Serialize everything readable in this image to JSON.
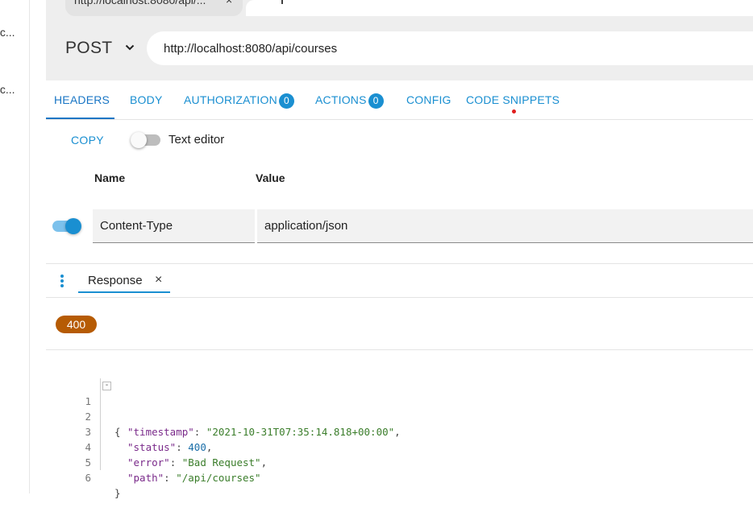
{
  "left_panel": {
    "items": [
      "fc...",
      "fc..."
    ]
  },
  "browser_tab": {
    "title": "http://localhost:8080/api/...",
    "close": "×",
    "new_tab": "+"
  },
  "request": {
    "method": "POST",
    "url": "http://localhost:8080/api/courses"
  },
  "tabs": [
    {
      "label": "HEADERS"
    },
    {
      "label": "BODY"
    },
    {
      "label": "AUTHORIZATION",
      "badge": "0"
    },
    {
      "label": "ACTIONS",
      "badge": "0"
    },
    {
      "label": "CONFIG"
    },
    {
      "label": "CODE SNIPPETS"
    }
  ],
  "headers_panel": {
    "copy_label": "COPY",
    "text_editor_label": "Text editor",
    "col_name": "Name",
    "col_value": "Value",
    "rows": [
      {
        "name": "Content-Type",
        "value": "application/json",
        "enabled": true
      }
    ]
  },
  "response": {
    "tab_label": "Response",
    "close": "×",
    "status": "400",
    "status_color": "#b65b04",
    "body_lines": [
      {
        "n": "1",
        "text": "{"
      },
      {
        "n": "2",
        "key": "\"timestamp\"",
        "value": "\"2021-10-31T07:35:14.818+00:00\"",
        "type": "str",
        "trail": ","
      },
      {
        "n": "3",
        "key": "\"status\"",
        "value": "400",
        "type": "num",
        "trail": ","
      },
      {
        "n": "4",
        "key": "\"error\"",
        "value": "\"Bad Request\"",
        "type": "str",
        "trail": ","
      },
      {
        "n": "5",
        "key": "\"path\"",
        "value": "\"/api/courses\"",
        "type": "str",
        "trail": ""
      },
      {
        "n": "6",
        "text": "}"
      }
    ]
  },
  "colors": {
    "accent": "#1a8fd1",
    "url_bar_bg": "#eeeeee"
  }
}
